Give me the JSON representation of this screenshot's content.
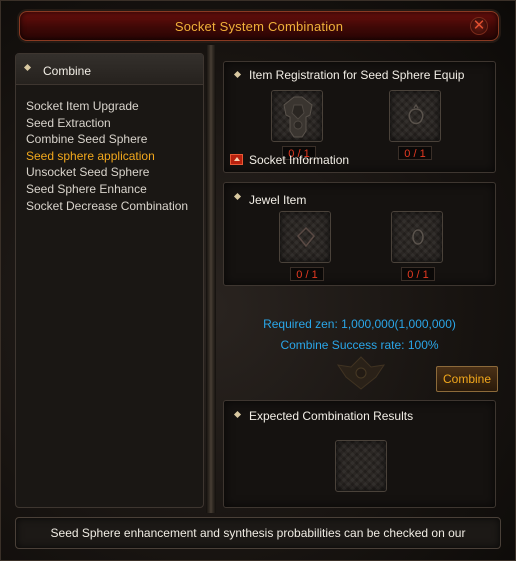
{
  "window": {
    "title": "Socket System Combination",
    "close_symbol": "✕"
  },
  "sidebar": {
    "header": "Combine",
    "items": [
      {
        "label": "Socket Item Upgrade",
        "active": false
      },
      {
        "label": "Seed Extraction",
        "active": false
      },
      {
        "label": "Combine Seed Sphere",
        "active": false
      },
      {
        "label": "Seed sphere application",
        "active": true
      },
      {
        "label": "Unsocket Seed Sphere",
        "active": false
      },
      {
        "label": "Seed Sphere Enhance",
        "active": false
      },
      {
        "label": "Socket Decrease Combination",
        "active": false
      }
    ]
  },
  "registration": {
    "title": "Item Registration for Seed Sphere Equip",
    "slot1_count": "0 / 1",
    "slot2_count": "0 / 1",
    "socket_info_label": "Socket Information"
  },
  "jewel": {
    "title": "Jewel Item",
    "slot1_count": "0 / 1",
    "slot2_count": "0 / 1"
  },
  "combine": {
    "required_zen": "Required zen: 1,000,000(1,000,000)",
    "success_rate": "Combine Success rate: 100%",
    "button_label": "Combine"
  },
  "results": {
    "title": "Expected Combination Results"
  },
  "footer": {
    "text": "Seed Sphere enhancement and synthesis probabilities can be checked on our"
  },
  "colors": {
    "accent_orange": "#f2a81c",
    "count_red": "#e63a22",
    "info_blue": "#2aa6e8",
    "title_bar_red": "#5a0c09"
  }
}
